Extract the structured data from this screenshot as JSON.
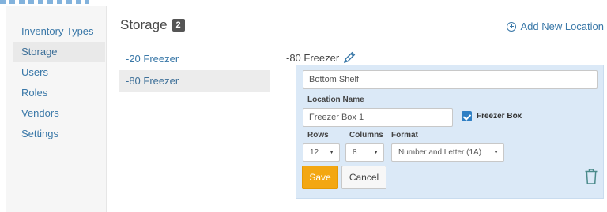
{
  "sidebar": {
    "items": [
      {
        "label": "Inventory Types",
        "active": false
      },
      {
        "label": "Storage",
        "active": true
      },
      {
        "label": "Users",
        "active": false
      },
      {
        "label": "Roles",
        "active": false
      },
      {
        "label": "Vendors",
        "active": false
      },
      {
        "label": "Settings",
        "active": false
      }
    ]
  },
  "header": {
    "title": "Storage",
    "count": "2",
    "add_link": "Add New Location",
    "add_icon": "plus-circle-icon"
  },
  "locations": [
    {
      "label": "-20 Freezer",
      "active": false
    },
    {
      "label": "-80 Freezer",
      "active": true
    }
  ],
  "detail": {
    "title": "-80 Freezer",
    "edit_icon": "pencil-icon",
    "form": {
      "shelf_value": "Bottom Shelf",
      "location_name_label": "Location Name",
      "location_name_value": "Freezer Box 1",
      "freezer_box_label": "Freezer Box",
      "freezer_box_checked": true,
      "rows_label": "Rows",
      "rows_value": "12",
      "columns_label": "Columns",
      "columns_value": "8",
      "format_label": "Format",
      "format_value": "Number and Letter (1A)",
      "save_label": "Save",
      "cancel_label": "Cancel",
      "delete_icon": "trash-icon"
    }
  },
  "colors": {
    "link": "#3a78a8",
    "save": "#f3a712",
    "checkbox": "#2f7fc4",
    "editor_bg": "#dbe9f7",
    "badge": "#555555"
  }
}
